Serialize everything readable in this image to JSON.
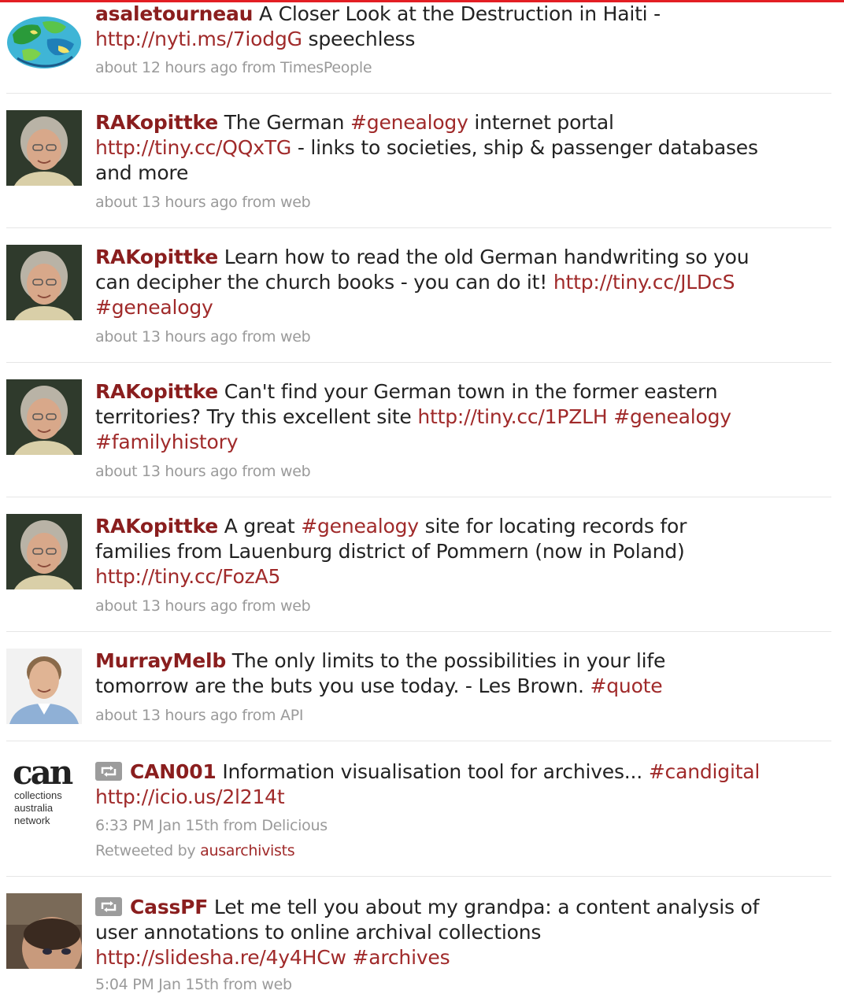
{
  "colors": {
    "accent": "#e31e24",
    "username": "#8a1e1e",
    "link": "#a02a2a",
    "meta": "#9a9a9a"
  },
  "tweets": [
    {
      "user": "asaletourneau",
      "parts": [
        {
          "t": "text",
          "v": " A Closer Look at the Destruction in Haiti - "
        },
        {
          "t": "link",
          "v": "http://nyti.ms/7iodgG"
        },
        {
          "t": "text",
          "v": " speechless"
        }
      ],
      "time": "about 12 hours ago",
      "from_label": "from",
      "source": "TimesPeople"
    },
    {
      "user": "RAKopittke",
      "parts": [
        {
          "t": "text",
          "v": " The German "
        },
        {
          "t": "link",
          "v": "#genealogy"
        },
        {
          "t": "text",
          "v": " internet portal "
        },
        {
          "t": "link",
          "v": "http://tiny.cc/QQxTG"
        },
        {
          "t": "text",
          "v": " - links to societies, ship & passenger databases and more"
        }
      ],
      "time": "about 13 hours ago",
      "from_label": "from",
      "source": "web"
    },
    {
      "user": "RAKopittke",
      "parts": [
        {
          "t": "text",
          "v": " Learn how to read the old German handwriting so you can decipher the church books - you can do it! "
        },
        {
          "t": "link",
          "v": "http://tiny.cc/JLDcS"
        },
        {
          "t": "text",
          "v": " "
        },
        {
          "t": "link",
          "v": "#genealogy"
        }
      ],
      "time": "about 13 hours ago",
      "from_label": "from",
      "source": "web"
    },
    {
      "user": "RAKopittke",
      "parts": [
        {
          "t": "text",
          "v": " Can't find your German town in the former eastern territories? Try this excellent site "
        },
        {
          "t": "link",
          "v": "http://tiny.cc/1PZLH"
        },
        {
          "t": "text",
          "v": " "
        },
        {
          "t": "link",
          "v": "#genealogy"
        },
        {
          "t": "text",
          "v": " "
        },
        {
          "t": "link",
          "v": "#familyhistory"
        }
      ],
      "time": "about 13 hours ago",
      "from_label": "from",
      "source": "web"
    },
    {
      "user": "RAKopittke",
      "parts": [
        {
          "t": "text",
          "v": " A great "
        },
        {
          "t": "link",
          "v": "#genealogy"
        },
        {
          "t": "text",
          "v": " site for locating records for families from Lauenburg district of Pommern (now in Poland) "
        },
        {
          "t": "link",
          "v": "http://tiny.cc/FozA5"
        }
      ],
      "time": "about 13 hours ago",
      "from_label": "from",
      "source": "web"
    },
    {
      "user": "MurrayMelb",
      "parts": [
        {
          "t": "text",
          "v": " The only limits to the possibilities in your life tomorrow are the buts you use today. - Les Brown. "
        },
        {
          "t": "link",
          "v": "#quote"
        }
      ],
      "time": "about 13 hours ago",
      "from_label": "from",
      "source": "API"
    },
    {
      "user": "CAN001",
      "retweet_icon": "retweet-icon",
      "parts": [
        {
          "t": "text",
          "v": " Information visualisation tool for archives... "
        },
        {
          "t": "link",
          "v": "#candigital"
        },
        {
          "t": "text",
          "v": " "
        },
        {
          "t": "link",
          "v": "http://icio.us/2l214t"
        }
      ],
      "time": "6:33 PM Jan 15th",
      "from_label": "from",
      "source": "Delicious",
      "retweeted_label": "Retweeted by",
      "retweeted_by": "ausarchivists",
      "avatar_text": {
        "big": "can",
        "line1": "collections",
        "line2": "australia",
        "line3": "network"
      }
    },
    {
      "user": "CassPF",
      "retweet_icon": "retweet-icon",
      "parts": [
        {
          "t": "text",
          "v": " Let me tell you about my grandpa: a content analysis of user annotations to online archival collections "
        },
        {
          "t": "link",
          "v": "http://slidesha.re/4y4HCw"
        },
        {
          "t": "text",
          "v": " "
        },
        {
          "t": "link",
          "v": "#archives"
        }
      ],
      "time": "5:04 PM Jan 15th",
      "from_label": "from",
      "source": "web"
    }
  ]
}
